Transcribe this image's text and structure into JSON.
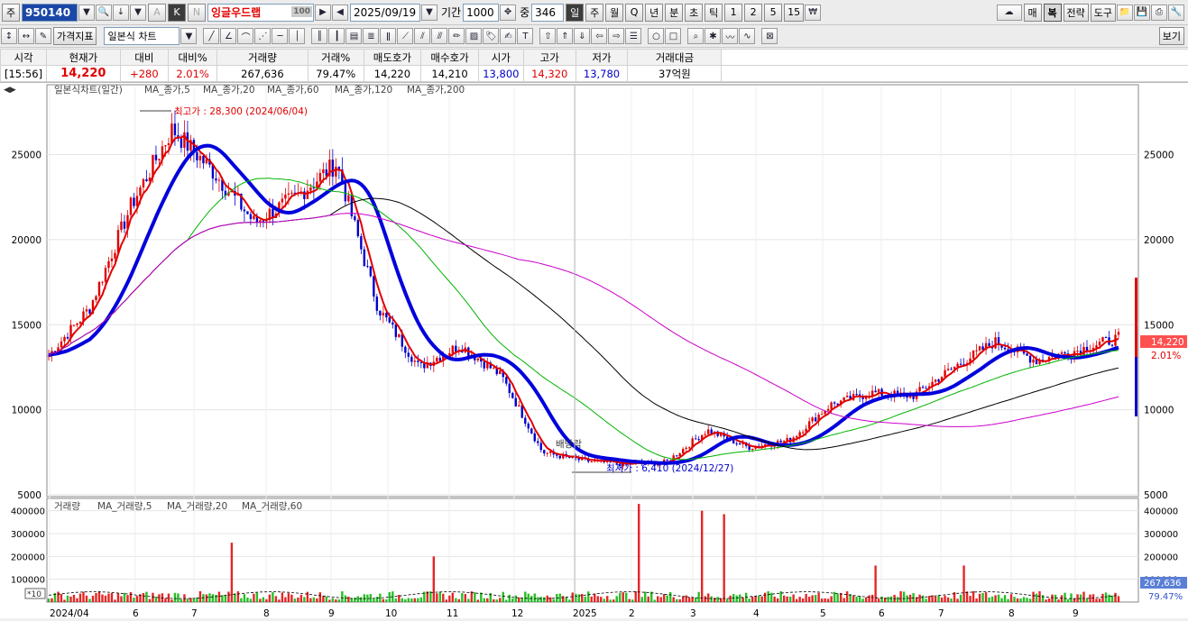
{
  "toolbar1": {
    "market": "주",
    "code": "950140",
    "name": "잉글우드랩",
    "name_badge": "100",
    "date": "2025/09/19",
    "period_label": "기간",
    "period_value": "1000",
    "count_label": "중",
    "count_value": "346",
    "k_label": "K",
    "n_label": "N",
    "a_label": "A",
    "timeframes": [
      "일",
      "주",
      "월",
      "Q",
      "년",
      "분",
      "초",
      "틱",
      "1",
      "2",
      "5",
      "15"
    ],
    "right_buttons": [
      "매",
      "복",
      "전략",
      "도구"
    ]
  },
  "toolbar2": {
    "price_indicator": "가격지표",
    "chart_type": "일본식 차트",
    "right_button": "보기"
  },
  "quote": {
    "headers": [
      "시각",
      "현재가",
      "대비",
      "대비%",
      "거래량",
      "거래%",
      "매도호가",
      "매수호가",
      "시가",
      "고가",
      "저가",
      "거래대금"
    ],
    "values": [
      "[15:56]",
      "14,220",
      "+280",
      "2.01%",
      "267,636",
      "79.47%",
      "14,220",
      "14,210",
      "13,800",
      "14,320",
      "13,780",
      "37억원"
    ]
  },
  "legend": {
    "price": "일본식차트(일간)",
    "ma": [
      "MA_종가,5",
      "MA_종가,20",
      "MA_종가,60",
      "MA_종가,120",
      "MA_종가,200"
    ],
    "volume": "거래량",
    "vol_ma": [
      "MA_거래량,5",
      "MA_거래량,20",
      "MA_거래량,60"
    ]
  },
  "annotations": {
    "high": "최고가 : 28,300 (2024/06/04)",
    "low": "최저가 : 6,410 (2024/12/27)",
    "dividend": "배당락",
    "last_price": "14,220",
    "last_pct": "2.01%",
    "last_vol": "267,636",
    "last_vol_pct": "79.47%",
    "vol_unit": "*10"
  },
  "colors": {
    "ma5": "#e00000",
    "ma20": "#00b400",
    "ma60": "#0000dd",
    "ma120": "#000000",
    "ma200": "#cc00cc",
    "up": "#e00000",
    "down": "#0000cc"
  },
  "chart_data": {
    "type": "candlestick",
    "price_axis": {
      "ticks": [
        5000,
        10000,
        15000,
        20000,
        25000
      ],
      "range": [
        5000,
        29000
      ]
    },
    "volume_axis": {
      "ticks": [
        100000,
        200000,
        300000,
        400000
      ],
      "range": [
        0,
        450000
      ]
    },
    "x_labels": [
      "2024/04",
      "6",
      "7",
      "8",
      "9",
      "10",
      "11",
      "12",
      "2025",
      "2",
      "3",
      "4",
      "5",
      "6",
      "7",
      "8",
      "9"
    ],
    "price_path": [
      [
        "2024/04",
        13200
      ],
      [
        "2024/05",
        16000
      ],
      [
        "2024/05",
        22000
      ],
      [
        "2024/06",
        26500
      ],
      [
        "2024/06",
        24000
      ],
      [
        "2024/07",
        21000
      ],
      [
        "2024/07",
        22500
      ],
      [
        "2024/08",
        24500
      ],
      [
        "2024/08",
        16000
      ],
      [
        "2024/09",
        12500
      ],
      [
        "2024/10",
        13800
      ],
      [
        "2024/11",
        12000
      ],
      [
        "2024/11",
        7500
      ],
      [
        "2024/12",
        7000
      ],
      [
        "2024/12",
        6800
      ],
      [
        "2025/01",
        6900
      ],
      [
        "2025/02",
        8800
      ],
      [
        "2025/03",
        7800
      ],
      [
        "2025/04",
        8200
      ],
      [
        "2025/04",
        10300
      ],
      [
        "2025/05",
        11000
      ],
      [
        "2025/06",
        10800
      ],
      [
        "2025/07",
        12500
      ],
      [
        "2025/08",
        14000
      ],
      [
        "2025/08",
        12900
      ],
      [
        "2025/09",
        13500
      ],
      [
        "2025/09",
        14220
      ]
    ],
    "volume_peaks": [
      [
        "2024/07",
        260000
      ],
      [
        "2024/10",
        200000
      ],
      [
        "2025/02",
        430000
      ],
      [
        "2025/04",
        400000
      ],
      [
        "2025/04",
        385000
      ],
      [
        "2025/07",
        160000
      ],
      [
        "2025/08",
        160000
      ]
    ]
  }
}
